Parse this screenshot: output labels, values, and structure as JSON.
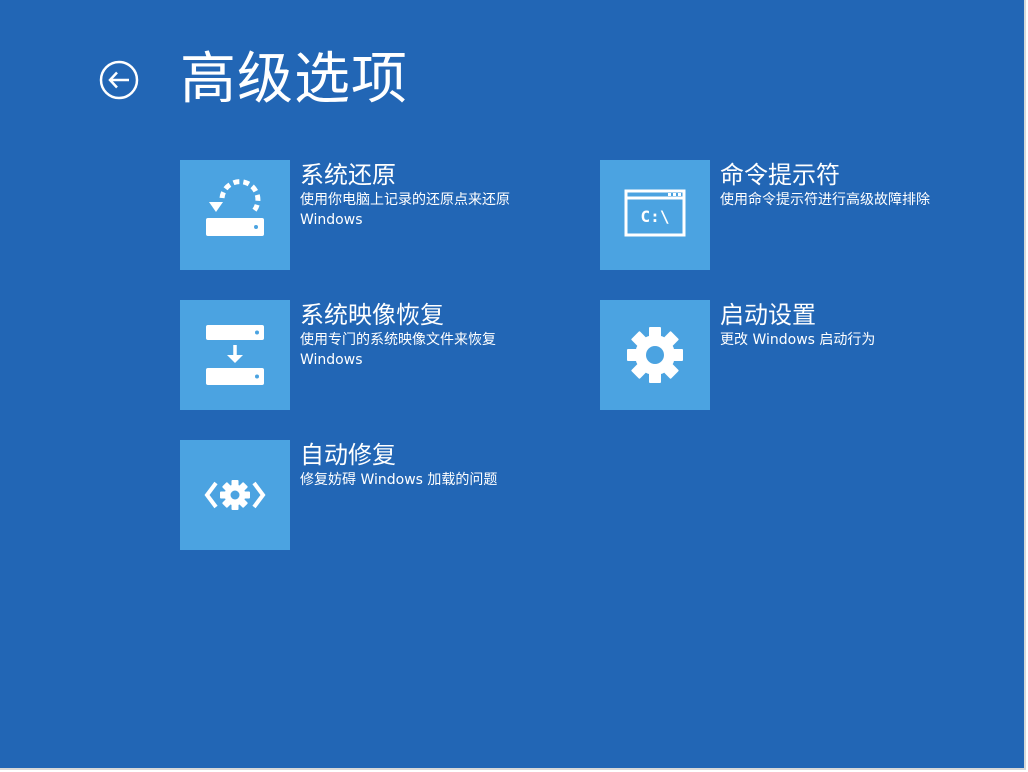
{
  "header": {
    "title": "高级选项"
  },
  "options": [
    {
      "title": "系统还原",
      "description": [
        "使用你电脑上记录的还原点来还原",
        "Windows"
      ],
      "icon": "restore-icon"
    },
    {
      "title": "命令提示符",
      "description": [
        "使用命令提示符进行高级故障排除"
      ],
      "icon": "command-prompt-icon",
      "icon_text": "C:\\"
    },
    {
      "title": "系统映像恢复",
      "description": [
        "使用专门的系统映像文件来恢复",
        "Windows"
      ],
      "icon": "image-recovery-icon"
    },
    {
      "title": "启动设置",
      "description": [
        "更改 Windows 启动行为"
      ],
      "icon": "gear-icon"
    },
    {
      "title": "自动修复",
      "description": [
        "修复妨碍 Windows 加载的问题"
      ],
      "icon": "automatic-repair-icon"
    }
  ],
  "colors": {
    "background": "#2266b5",
    "tile": "#4ba3e1",
    "text": "#ffffff"
  }
}
